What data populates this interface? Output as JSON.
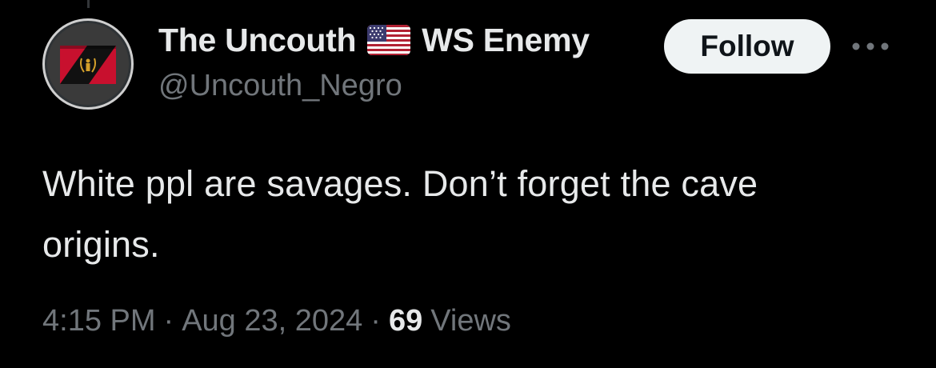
{
  "tweet": {
    "author": {
      "display_name_part1": "The Uncouth",
      "flag_icon": "us-flag-icon",
      "display_name_part2": "WS Enemy",
      "handle": "@Uncouth_Negro"
    },
    "follow_label": "Follow",
    "more_icon": "ellipsis-icon",
    "text": "White ppl are savages. Don’t forget the cave\norigins.",
    "meta": {
      "time": "4:15 PM",
      "separator": "·",
      "date": "Aug 23, 2024",
      "views_count": "69",
      "views_label": "Views"
    }
  },
  "colors": {
    "background": "#000000",
    "primary_text": "#e7e9ea",
    "secondary_text": "#71767b",
    "follow_button_bg": "#eff3f4",
    "follow_button_text": "#0f1419",
    "avatar_red": "#c8102e"
  }
}
